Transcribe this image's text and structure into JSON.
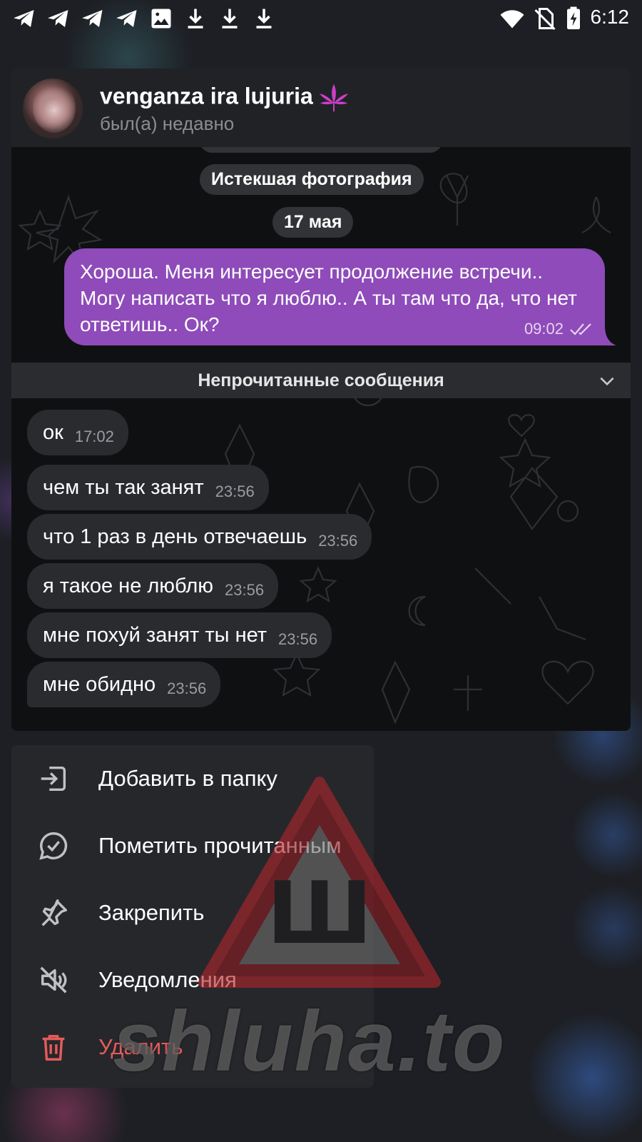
{
  "status_bar": {
    "time": "6:12",
    "left_icons": [
      "telegram-icon",
      "telegram-icon",
      "telegram-icon",
      "telegram-icon",
      "image-icon",
      "download-icon",
      "download-icon",
      "download-icon"
    ],
    "right_icons": [
      "wifi-icon",
      "no-sim-icon",
      "battery-charging-icon"
    ]
  },
  "chat": {
    "contact_name": "venganza ira lujuria",
    "contact_status": "был(а) недавно",
    "expired_photo": "Истекшая фотография",
    "date_label": "17 мая",
    "outgoing": {
      "text": "Хороша. Меня интересует продолжение встречи.. Могу написать что я люблю.. А ты там что да, что нет ответишь.. Ок?",
      "time": "09:02",
      "read": true
    },
    "unread_label": "Непрочитанные сообщения",
    "incoming": [
      {
        "text": "ок",
        "time": "17:02"
      },
      {
        "text": "чем ты так занят",
        "time": "23:56"
      },
      {
        "text": "что 1 раз в день отвечаешь",
        "time": "23:56"
      },
      {
        "text": "я такое не люблю",
        "time": "23:56"
      },
      {
        "text": "мне похуй занят ты нет",
        "time": "23:56"
      },
      {
        "text": "мне обидно",
        "time": "23:56"
      }
    ]
  },
  "menu": {
    "items": [
      {
        "label": "Добавить в папку",
        "icon": "folder-add-icon"
      },
      {
        "label": "Пометить прочитанным",
        "icon": "mark-read-icon"
      },
      {
        "label": "Закрепить",
        "icon": "pin-icon"
      },
      {
        "label": "Уведомления",
        "icon": "mute-icon"
      },
      {
        "label": "Удалить",
        "icon": "trash-icon"
      }
    ]
  },
  "colors": {
    "outgoing_bubble": "#8e4bb9",
    "incoming_bubble": "#2a2b2f",
    "menu_background": "#26272b",
    "danger": "#e55b5b",
    "watermark": "#c0272d"
  },
  "watermark": {
    "text": "shluha.to",
    "sign_letter": "Ш"
  }
}
